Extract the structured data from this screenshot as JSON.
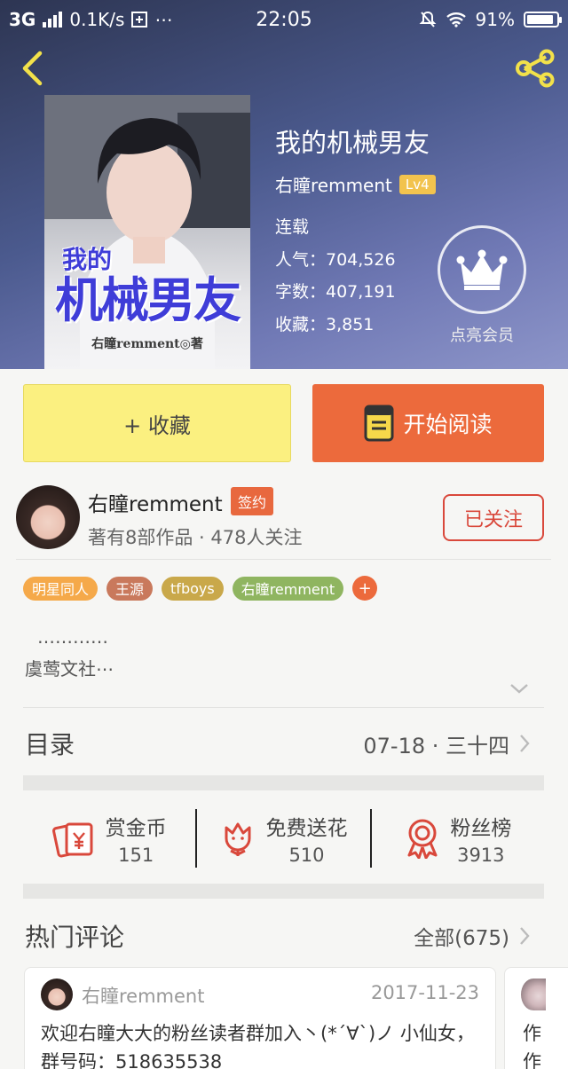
{
  "status_bar": {
    "network": "3G",
    "speed": "0.1K/s",
    "extra": "⋯",
    "time": "22:05",
    "battery": "91%",
    "battery_level": 0.91
  },
  "book": {
    "title": "我的机械男友",
    "author": "右瞳remment",
    "level": "Lv4",
    "status": "连载",
    "popularity": "人气：704,526",
    "word_count": "字数：407,191",
    "favorites": "收藏：3,851",
    "vip_label": "点亮会员",
    "cover_title_small": "我的",
    "cover_title_large": "机械男友",
    "cover_author": "右瞳remment◎著"
  },
  "actions": {
    "favorite_label": "+ 收藏",
    "read_label": "开始阅读"
  },
  "author": {
    "name": "右瞳remment",
    "badge": "签约",
    "stats": "著有8部作品 · 478人关注",
    "follow_label": "已关注"
  },
  "tags": [
    {
      "label": "明星同人",
      "color": "#f5a94a"
    },
    {
      "label": "王源",
      "color": "#c9795c"
    },
    {
      "label": "tfboys",
      "color": "#c9a84a"
    },
    {
      "label": "右瞳remment",
      "color": "#8fb560"
    }
  ],
  "tag_add_label": "+",
  "description": {
    "line1": "…………",
    "line2": "虞莺文社⋯"
  },
  "catalog": {
    "label": "目录",
    "latest": "07-18 · 三十四"
  },
  "stats": [
    {
      "label": "赏金币",
      "value": "151",
      "icon": "reward-coin-icon"
    },
    {
      "label": "免费送花",
      "value": "510",
      "icon": "flower-icon"
    },
    {
      "label": "粉丝榜",
      "value": "3913",
      "icon": "medal-icon"
    }
  ],
  "comments": {
    "title": "热门评论",
    "all_label": "全部(675)",
    "items": [
      {
        "user": "右瞳remment",
        "date": "2017-11-23",
        "text": "欢迎右瞳大大的粉丝读者群加入丶(*´∀`)ノ 小仙女，群号码：518635538"
      },
      {
        "text": "作\n作"
      }
    ]
  },
  "colors": {
    "accent": "#ec6a3c",
    "favorite_bg": "#fbf080",
    "follow": "#d9483b",
    "level_badge": "#f2c34e"
  }
}
